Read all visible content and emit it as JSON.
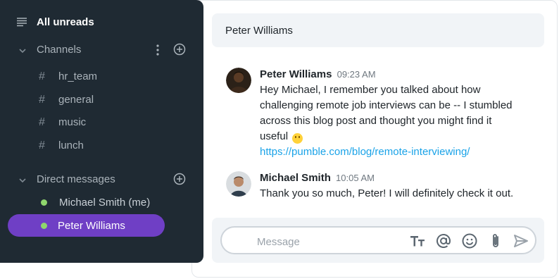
{
  "sidebar": {
    "all_unreads": "All unreads",
    "channels_section": "Channels",
    "channels": [
      {
        "label": "hr_team"
      },
      {
        "label": "general"
      },
      {
        "label": "music"
      },
      {
        "label": "lunch"
      }
    ],
    "dm_section": "Direct messages",
    "direct_messages": [
      {
        "label": "Michael Smith (me)",
        "status": "online"
      },
      {
        "label": "Peter Williams",
        "status": "online",
        "active": true
      }
    ]
  },
  "chat": {
    "title": "Peter Williams",
    "messages": [
      {
        "author": "Peter Williams",
        "time": "09:23 AM",
        "lines": [
          "Hey Michael, I remember you talked about how",
          "challenging remote job interviews can be -- I stumbled",
          "across this blog post and thought you might find it",
          "useful"
        ],
        "emoji": "slightly-smiling-face",
        "link": "https://pumble.com/blog/remote-interviewing/"
      },
      {
        "author": "Michael Smith",
        "time": "10:05 AM",
        "lines": [
          "Thank you so much, Peter! I will definitely check it out."
        ]
      }
    ],
    "composer": {
      "placeholder": "Message"
    }
  },
  "colors": {
    "sidebar_bg": "#1f2a33",
    "active_item": "#6f3fc5",
    "online_status": "#8fd66d",
    "link": "#1aa3e8"
  },
  "icons": [
    "list-icon",
    "chevron-down-icon",
    "more-vertical-icon",
    "plus-circle-icon",
    "hash-icon",
    "text-format-icon",
    "at-icon",
    "emoji-icon",
    "attachment-icon",
    "send-icon"
  ]
}
